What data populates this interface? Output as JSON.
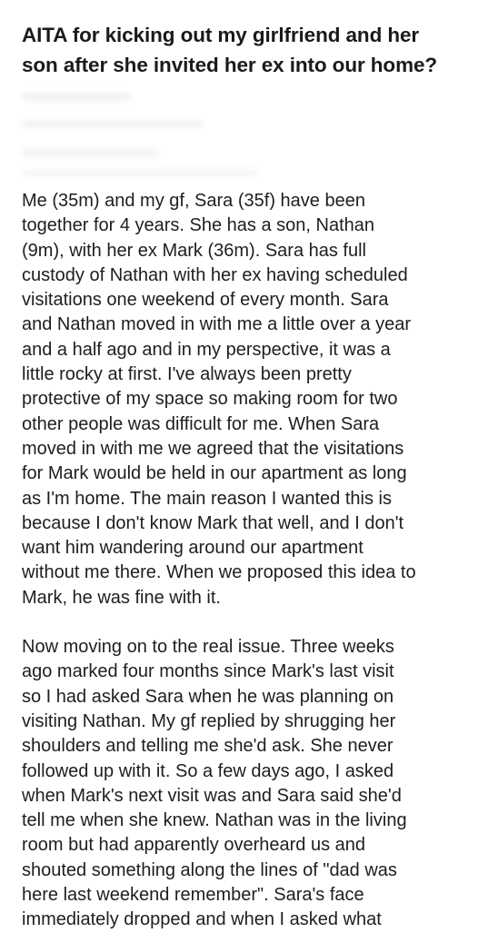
{
  "post": {
    "title_lines": [
      "AITA for kicking out my girlfriend and her",
      "son after she invited her ex into our home?"
    ],
    "paragraphs": [
      [
        "Me (35m) and my gf, Sara (35f) have been",
        "together for 4 years. She has a son, Nathan",
        "(9m), with her ex Mark (36m). Sara has full",
        "custody of Nathan with her ex having scheduled",
        "visitations one weekend of every month. Sara",
        "and Nathan moved in with me a little over a year",
        "and a half ago and in my perspective, it was a",
        "little rocky at first. I've always been pretty",
        "protective of my space so making room for two",
        "other people was difficult for me. When Sara",
        "moved in with me we agreed that the visitations",
        "for Mark would be held in our apartment as long",
        "as I'm home. The main reason I wanted this is",
        "because I don't know Mark that well, and I don't",
        "want him wandering around our apartment",
        "without me there. When we proposed this idea to",
        "Mark, he was fine with it."
      ],
      [
        "Now moving on to the real issue. Three weeks",
        "ago marked four months since Mark's last visit",
        "so I had asked Sara when he was planning on",
        "visiting Nathan. My gf replied by shrugging her",
        "shoulders and telling me she'd ask. She never",
        "followed up with it. So a few days ago, I asked",
        "when Mark's next visit was and Sara said she'd",
        "tell me when she knew. Nathan was in the living",
        "room but had apparently overheard us and",
        "shouted something along the lines of \"dad was",
        "here last weekend remember\". Sara's face",
        "immediately dropped and when I asked what"
      ]
    ]
  }
}
